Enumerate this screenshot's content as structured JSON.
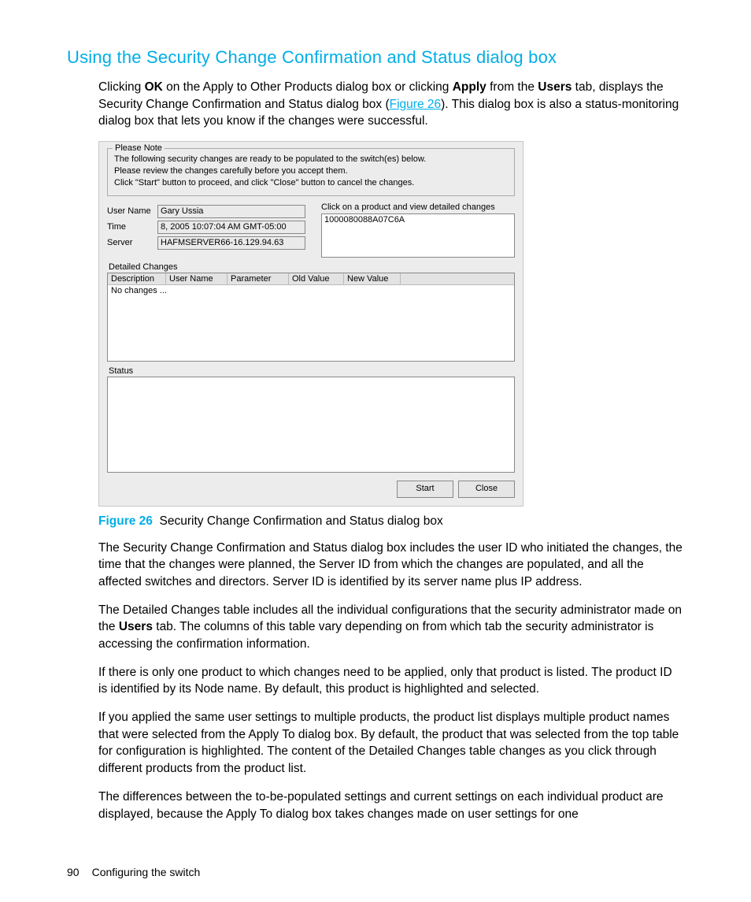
{
  "heading": "Using the Security Change Confirmation and Status dialog box",
  "intro": {
    "p1a": "Clicking ",
    "ok": "OK",
    "p1b": " on the Apply to Other Products dialog box or clicking ",
    "apply": "Apply",
    "p1c": " from the ",
    "users": "Users",
    "p1d": " tab, displays the Security Change Confirmation and Status dialog box (",
    "figlink": "Figure 26",
    "p1e": "). This dialog box is also a status-monitoring dialog box that lets you know if the changes were successful."
  },
  "dialog": {
    "note_legend": "Please Note",
    "note1": "The following security changes are ready to be populated to the switch(es) below.",
    "note2": "Please review the changes carefully before you accept them.",
    "note3": "Click \"Start\" button to proceed, and click \"Close\" button to cancel the changes.",
    "form": {
      "user_label": "User Name",
      "user_value": "Gary Ussia",
      "time_label": "Time",
      "time_value": "8, 2005 10:07:04 AM GMT-05:00",
      "server_label": "Server",
      "server_value": "HAFMSERVER66-16.129.94.63"
    },
    "products": {
      "hint": "Click on a product and view detailed changes",
      "items": [
        "1000080088A07C6A"
      ]
    },
    "detailed_label": "Detailed Changes",
    "table": {
      "cols": [
        "Description",
        "User Name",
        "Parameter",
        "Old Value",
        "New Value"
      ],
      "rows": [
        [
          "No changes ...",
          "",
          "",
          "",
          ""
        ]
      ]
    },
    "status_label": "Status",
    "buttons": {
      "start": "Start",
      "close": "Close"
    }
  },
  "caption": {
    "label": "Figure 26",
    "text": "Security Change Confirmation and Status dialog box"
  },
  "paras": {
    "p2": "The Security Change Confirmation and Status dialog box includes the user ID who initiated the changes, the time that the changes were planned, the Server ID from which the changes are populated, and all the affected switches and directors. Server ID is identified by its server name plus IP address.",
    "p3a": "The Detailed Changes table includes all the individual configurations that the security administrator made on the ",
    "p3_users": "Users",
    "p3b": " tab. The columns of this table vary depending on from which tab the security administrator is accessing the confirmation information.",
    "p4": "If there is only one product to which changes need to be applied, only that product is listed. The product ID is identified by its Node name. By default, this product is highlighted and selected.",
    "p5": "If you applied the same user settings to multiple products, the product list displays multiple product names that were selected from the Apply To dialog box. By default, the product that was selected from the top table for configuration is highlighted. The content of the Detailed Changes table changes as you click through different products from the product list.",
    "p6": "The differences between the to-be-populated settings and current settings on each individual product are displayed, because the Apply To dialog box takes changes made on user settings for one"
  },
  "footer": {
    "pagenum": "90",
    "section": "Configuring the switch"
  }
}
